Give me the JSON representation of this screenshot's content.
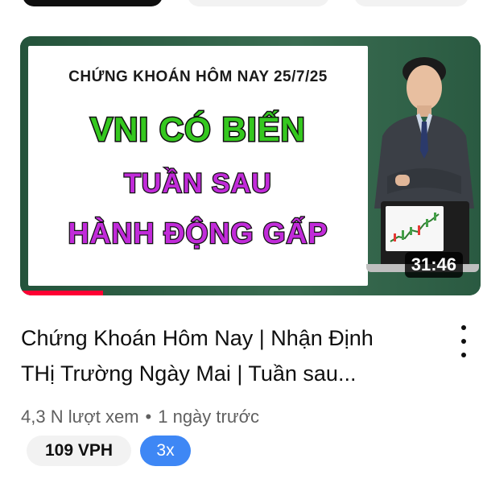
{
  "thumbnail": {
    "banner_line1": "CHỨNG KHOÁN HÔM NAY 25/7/25",
    "banner_line2": "VNI CÓ BIẾN",
    "banner_line3": "TUẦN SAU",
    "banner_line4": "HÀNH ĐỘNG GẤP",
    "duration": "31:46",
    "watch_progress": 0.18,
    "colors": {
      "green_text": "#35c81f",
      "magenta_text": "#c12bd9",
      "progress": "#ff0033"
    }
  },
  "video": {
    "title_line1": "Chứng Khoán Hôm Nay | Nhận Định",
    "title_line2": "THị Trường Ngày Mai | Tuần sau...",
    "views": "4,3 N lượt xem",
    "separator": "•",
    "age": "1 ngày trước",
    "more_icon": "more-vert-icon"
  },
  "badges": {
    "vph": "109 VPH",
    "multiplier": "3x",
    "multiplier_color": "#3e87f5"
  }
}
